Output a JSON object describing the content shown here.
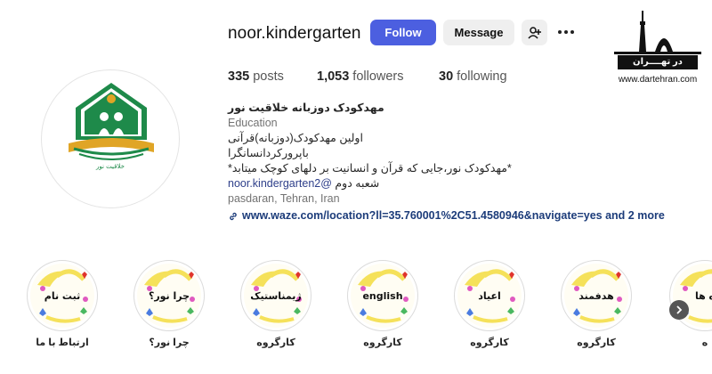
{
  "profile": {
    "username": "noor.kindergarten",
    "follow_label": "Follow",
    "message_label": "Message",
    "stats": {
      "posts_count": "335",
      "posts_label": "posts",
      "followers_count": "1,053",
      "followers_label": "followers",
      "following_count": "30",
      "following_label": "following"
    },
    "avatar_caption": "خلاقیت نور"
  },
  "bio": {
    "name": "مهدکودک دوزبانه خلاقیت نور",
    "category": "Education",
    "lines": [
      "اولین مهدکودک(دوزبانه)قرآنی",
      "باپرورکردانسانگرا",
      "*مهدکودک نور،جایی که قرآن و انسانیت بر دلهای کوچک میتابد*"
    ],
    "branch_tag": "noor.kindergarten2@",
    "branch_label": "شعبه دوم",
    "location": "pasdaran, Tehran, Iran",
    "link_text": "www.waze.com/location?ll=35.760001%2C51.4580946&navigate=yes and 2 more"
  },
  "watermark": {
    "banner_text": "در تهــــران",
    "site": "www.dartehran.com"
  },
  "highlights": [
    {
      "title": "ثبت نام",
      "caption": "ارتباط با ما"
    },
    {
      "title": "چرا نور؟",
      "caption": "چرا نور؟"
    },
    {
      "title": "ژیمناستیک",
      "caption": "کارگروه"
    },
    {
      "title": "english",
      "caption": "کارگروه"
    },
    {
      "title": "اعیاد",
      "caption": "کارگروه"
    },
    {
      "title": "هدفمند",
      "caption": "کارگروه"
    },
    {
      "title": "ه ها",
      "caption": "ه"
    }
  ],
  "colors": {
    "follow_button": "#4c5fe0",
    "logo_green": "#1e8a4a",
    "logo_gold": "#e0a526"
  },
  "icons": {
    "add_user": "person-plus-icon",
    "more": "more-horizontal-icon",
    "link": "link-icon",
    "next": "chevron-right-icon"
  }
}
